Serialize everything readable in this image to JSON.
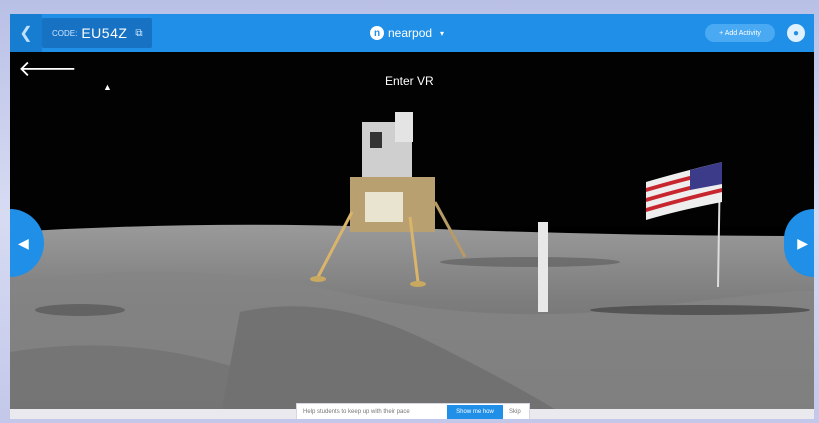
{
  "header": {
    "back_icon": "chevron-left-icon",
    "code_label": "CODE:",
    "code_value": "EU54Z",
    "copy_icon": "copy-icon",
    "brand_name": "nearpod",
    "brand_caret": "▾",
    "add_activity_label": "+ Add Activity",
    "user_icon": "user-icon"
  },
  "viewer": {
    "enter_vr_label": "Enter VR",
    "exit_icon": "arrow-left-icon",
    "prev_icon": "chevron-left-icon",
    "next_icon": "chevron-right-icon"
  },
  "footer": {
    "tooltip_text": "Help students to keep up with their pace",
    "show_me_label": "Show me how",
    "skip_label": "Skip"
  },
  "colors": {
    "brand_blue": "#1f8fe8",
    "sky": "#000000",
    "moon_surface": "#8a8a8a"
  }
}
